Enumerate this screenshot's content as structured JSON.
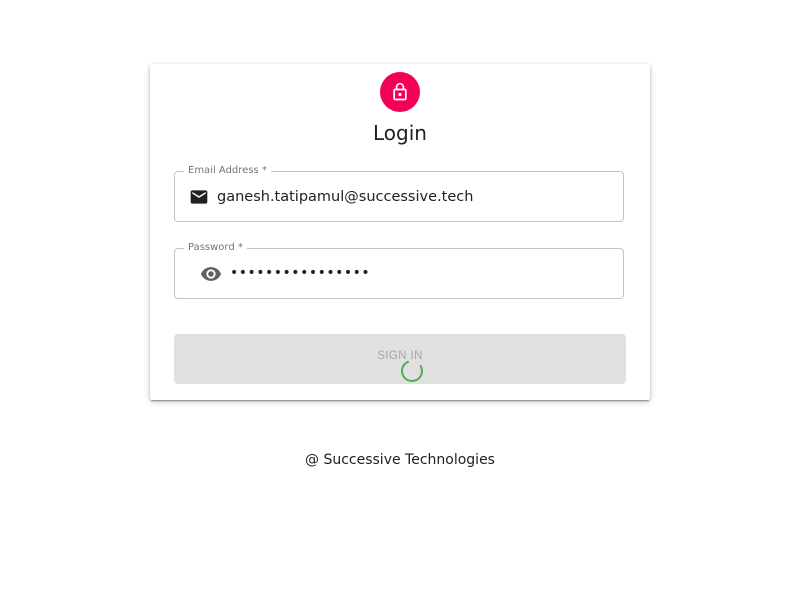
{
  "login": {
    "title": "Login",
    "avatar_icon": "lock-outline-icon",
    "email": {
      "label": "Email Address *",
      "value": "ganesh.tatipamul@successive.tech",
      "icon": "email-icon"
    },
    "password": {
      "label": "Password *",
      "value": "••••••••••••••••",
      "icon": "eye-icon"
    },
    "submit": {
      "label": "SIGN IN",
      "state": "loading"
    }
  },
  "footer": {
    "text": "@ Successive Technologies"
  },
  "colors": {
    "accent": "#f50057",
    "spinner": "#4caf50",
    "disabled_button": "#e0e0e0"
  }
}
